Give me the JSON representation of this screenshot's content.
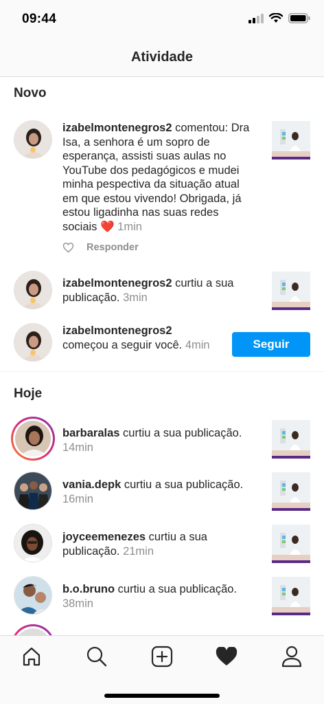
{
  "status": {
    "time": "09:44"
  },
  "header": {
    "title": "Atividade"
  },
  "sections": {
    "new_title": "Novo",
    "today_title": "Hoje"
  },
  "new_items": [
    {
      "user": "izabelmontenegros2",
      "action": " comentou: Dra Isa, a senhora é um sopro de esperança, assisti suas aulas no YouTube dos pedagógicos e mudei minha pespectiva da situação atual em que estou vivendo! Obrigada, já estou ligadinha nas suas redes sociais ❤️",
      "time": " 1min",
      "reply_label": "Responder"
    },
    {
      "user": "izabelmontenegros2",
      "action": " curtiu a sua publicação.",
      "time": " 3min"
    },
    {
      "user": "izabelmontenegros2",
      "action": " começou a seguir você.",
      "time": " 4min",
      "button": "Seguir"
    }
  ],
  "today_items": [
    {
      "user": "barbaralas",
      "action": " curtiu a sua publicação.",
      "time": " 14min"
    },
    {
      "user": "vania.depk",
      "action": " curtiu a sua publicação.",
      "time": " 16min"
    },
    {
      "user": "joyceemenezes",
      "action": " curtiu a sua publicação.",
      "time": " 21min"
    },
    {
      "user": "b.o.bruno",
      "action": " curtiu a sua publicação.",
      "time": " 38min"
    }
  ],
  "tabs": [
    {
      "icon": "home-icon"
    },
    {
      "icon": "search-icon"
    },
    {
      "icon": "add-post-icon"
    },
    {
      "icon": "activity-heart-icon"
    },
    {
      "icon": "profile-icon"
    }
  ],
  "colors": {
    "accent": "#0095f6",
    "heart": "#ed4956",
    "muted": "#8e8e8e"
  }
}
